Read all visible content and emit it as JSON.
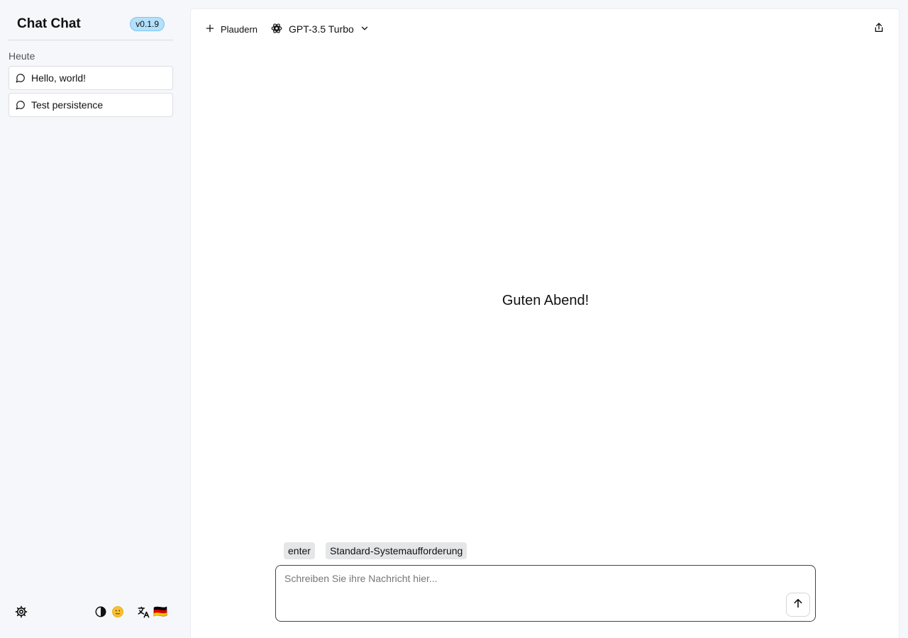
{
  "sidebar": {
    "app_title": "Chat Chat",
    "version": "v0.1.9",
    "section_label": "Heute",
    "chats": [
      {
        "label": "Hello, world!"
      },
      {
        "label": "Test persistence"
      }
    ],
    "footer": {
      "settings_icon": "gear-icon",
      "theme_icon": "contrast-icon",
      "emoji_icon": "emoji-face-icon",
      "language_icon": "translate-icon",
      "flag": "🇩🇪"
    }
  },
  "header": {
    "new_chat_label": "Plaudern",
    "model_name": "GPT-3.5 Turbo",
    "share_icon": "share-icon"
  },
  "main": {
    "greeting": "Guten Abend!",
    "chips": [
      {
        "label": "enter"
      },
      {
        "label": "Standard-Systemaufforderung"
      }
    ],
    "composer": {
      "placeholder": "Schreiben Sie ihre Nachricht hier...",
      "value": ""
    }
  },
  "colors": {
    "background": "#f6f7fb",
    "panel": "#ffffff",
    "badge": "#b3e0fb",
    "chip": "#e5e6e8"
  }
}
